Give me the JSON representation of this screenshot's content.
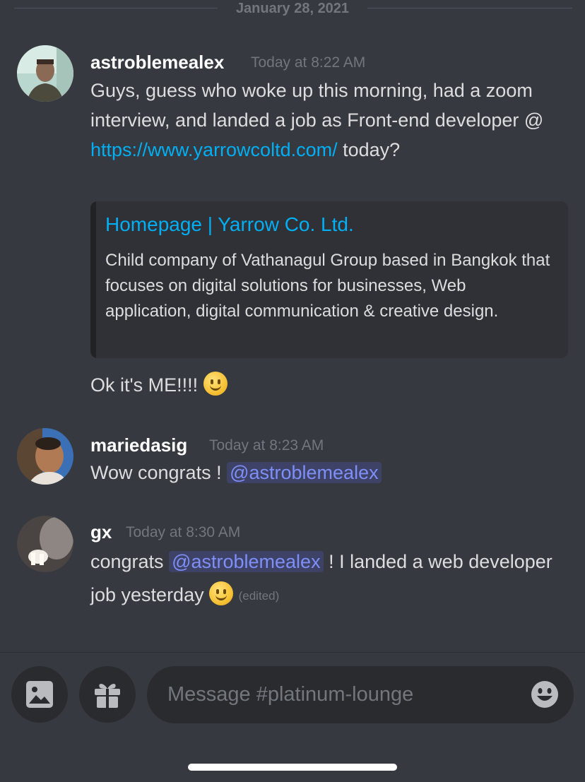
{
  "channel": {
    "date_divider": "January 28, 2021",
    "message_placeholder": "Message #platinum-lounge"
  },
  "messages": [
    {
      "author": "astroblemealex",
      "timestamp": "Today at 8:22 AM",
      "text_part1": "Guys, guess who woke up this morning, had a zoom interview, and landed a job as Front-end developer @ ",
      "link": "https://www.yarrowcoltd.com/",
      "text_part2": " today?",
      "embed": {
        "title": "Homepage | Yarrow Co. Ltd.",
        "description": "Child company of Vathanagul Group based in Bangkok that focuses on digital solutions for businesses, Web application,  digital communication & creative design."
      },
      "followup": "Ok it's ME!!!! "
    },
    {
      "author": "mariedasig",
      "timestamp": "Today at 8:23 AM",
      "text": "Wow congrats ! ",
      "mention": "@astroblemealex"
    },
    {
      "author": "gx",
      "timestamp": "Today at 8:30 AM",
      "text_before": "congrats ",
      "mention": "@astroblemealex",
      "text_after": " ! I landed a web developer job yesterday ",
      "edited": "(edited)"
    }
  ],
  "icons": {
    "image_button": "image-icon",
    "gift_button": "gift-icon",
    "emoji_button": "emoji-icon"
  },
  "colors": {
    "background": "#36393f",
    "link": "#00aff4",
    "mention": "#7e8ff8",
    "input_bg": "#292b2f"
  }
}
